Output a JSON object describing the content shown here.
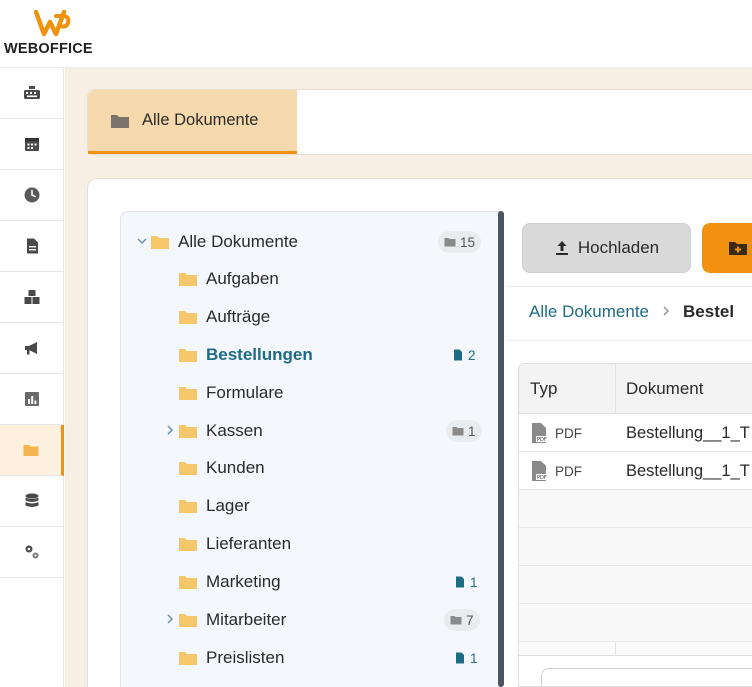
{
  "header": {
    "brand": "WEBOFFICE"
  },
  "rail": {
    "items": [
      {
        "icon": "keyboard-icon",
        "active": false
      },
      {
        "icon": "calendar-icon",
        "active": false
      },
      {
        "icon": "clock-icon",
        "active": false
      },
      {
        "icon": "document-icon",
        "active": false
      },
      {
        "icon": "boxes-icon",
        "active": false
      },
      {
        "icon": "megaphone-icon",
        "active": false
      },
      {
        "icon": "chart-icon",
        "active": false
      },
      {
        "icon": "folder-icon",
        "active": true
      },
      {
        "icon": "database-icon",
        "active": false
      },
      {
        "icon": "settings-icon",
        "active": false
      }
    ]
  },
  "tabs": {
    "active_label": "Alle Dokumente"
  },
  "tree": {
    "root": {
      "label": "Alle Dokumente",
      "count": "15"
    },
    "items": [
      {
        "label": "Aufgaben",
        "expandable": false,
        "count": "",
        "badge": ""
      },
      {
        "label": "Aufträge",
        "expandable": false,
        "count": "",
        "badge": ""
      },
      {
        "label": "Bestellungen",
        "expandable": false,
        "count": "2",
        "badge": "file",
        "selected": true
      },
      {
        "label": "Formulare",
        "expandable": false,
        "count": "",
        "badge": ""
      },
      {
        "label": "Kassen",
        "expandable": true,
        "count": "1",
        "badge": "folder"
      },
      {
        "label": "Kunden",
        "expandable": false,
        "count": "",
        "badge": ""
      },
      {
        "label": "Lager",
        "expandable": false,
        "count": "",
        "badge": ""
      },
      {
        "label": "Lieferanten",
        "expandable": false,
        "count": "",
        "badge": ""
      },
      {
        "label": "Marketing",
        "expandable": false,
        "count": "1",
        "badge": "file"
      },
      {
        "label": "Mitarbeiter",
        "expandable": true,
        "count": "7",
        "badge": "folder"
      },
      {
        "label": "Preislisten",
        "expandable": false,
        "count": "1",
        "badge": "file"
      }
    ]
  },
  "toolbar": {
    "upload_label": "Hochladen"
  },
  "breadcrumb": {
    "root": "Alle Dokumente",
    "separator": ">",
    "current": "Bestel"
  },
  "table": {
    "headers": {
      "type": "Typ",
      "document": "Dokument"
    },
    "rows": [
      {
        "type": "PDF",
        "document": "Bestellung__1_T"
      },
      {
        "type": "PDF",
        "document": "Bestellung__1_T"
      }
    ]
  },
  "colors": {
    "accent": "#f0920f",
    "link": "#1e6b86",
    "tab_bg": "#f6d9ad"
  }
}
